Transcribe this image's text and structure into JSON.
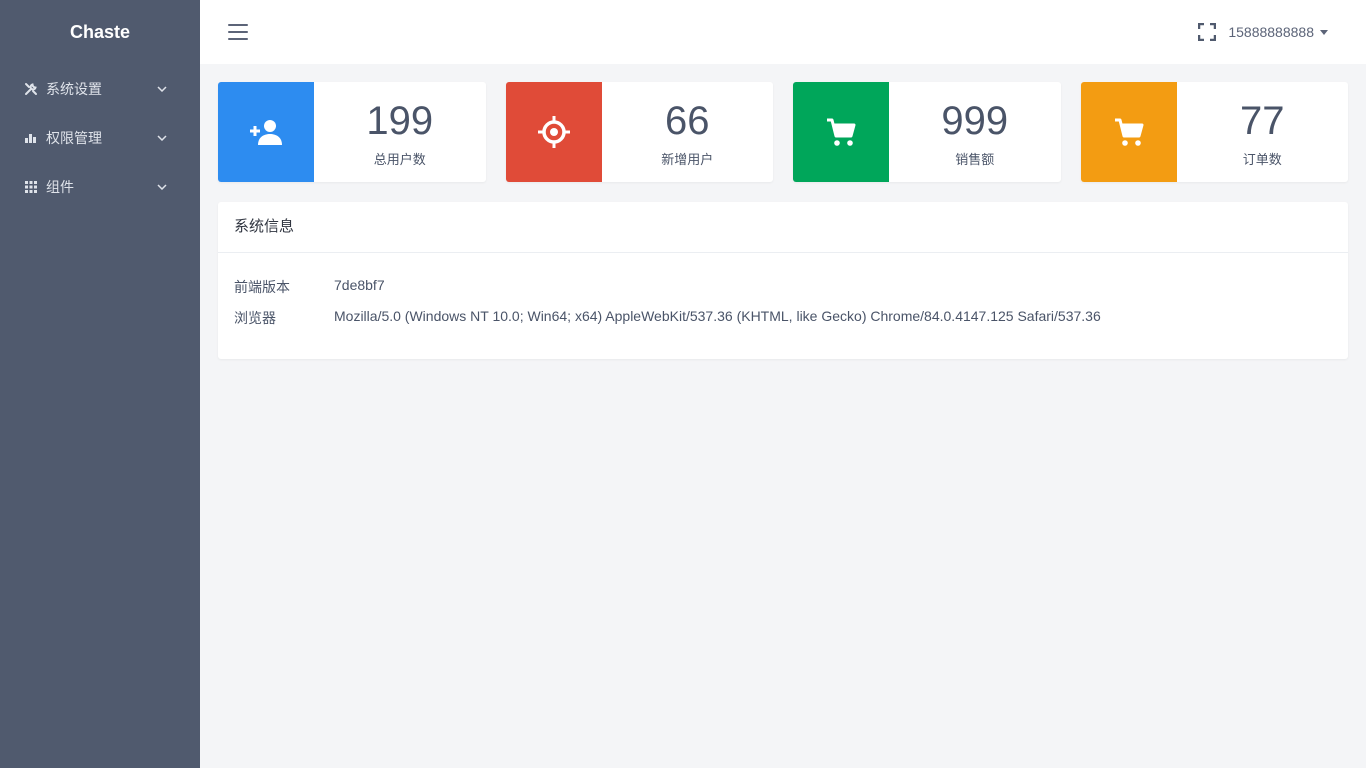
{
  "sidebar": {
    "brand": "Chaste",
    "items": [
      {
        "label": "系统设置",
        "icon": "tools-icon"
      },
      {
        "label": "权限管理",
        "icon": "bar-chart-icon"
      },
      {
        "label": "组件",
        "icon": "grid-icon"
      }
    ]
  },
  "header": {
    "user": "15888888888"
  },
  "stats": [
    {
      "value": "199",
      "label": "总用户数",
      "color": "#2d8cf0",
      "icon": "add-user-icon"
    },
    {
      "value": "66",
      "label": "新增用户",
      "color": "#e04b38",
      "icon": "target-icon"
    },
    {
      "value": "999",
      "label": "销售额",
      "color": "#00a65a",
      "icon": "cart-icon"
    },
    {
      "value": "77",
      "label": "订单数",
      "color": "#f39c12",
      "icon": "cart-icon"
    }
  ],
  "system_info": {
    "title": "系统信息",
    "rows": [
      {
        "key": "前端版本",
        "value": "7de8bf7"
      },
      {
        "key": "浏览器",
        "value": "Mozilla/5.0 (Windows NT 10.0; Win64; x64) AppleWebKit/537.36 (KHTML, like Gecko) Chrome/84.0.4147.125 Safari/537.36"
      }
    ]
  }
}
